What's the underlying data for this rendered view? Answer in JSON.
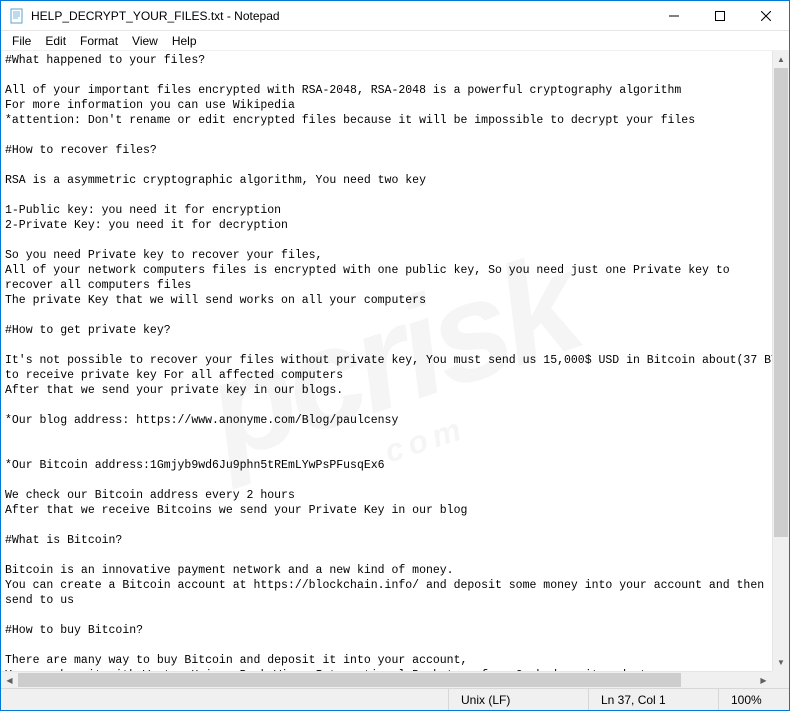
{
  "window": {
    "title": "HELP_DECRYPT_YOUR_FILES.txt - Notepad"
  },
  "menu": {
    "file": "File",
    "edit": "Edit",
    "format": "Format",
    "view": "View",
    "help": "Help"
  },
  "document": {
    "text": "#What happened to your files?\n\nAll of your important files encrypted with RSA-2048, RSA-2048 is a powerful cryptography algorithm\nFor more information you can use Wikipedia\n*attention: Don't rename or edit encrypted files because it will be impossible to decrypt your files\n\n#How to recover files?\n\nRSA is a asymmetric cryptographic algorithm, You need two key\n\n1-Public key: you need it for encryption\n2-Private Key: you need it for decryption\n\nSo you need Private key to recover your files,\nAll of your network computers files is encrypted with one public key, So you need just one Private key to\nrecover all computers files\nThe private Key that we will send works on all your computers\n\n#How to get private key?\n\nIt's not possible to recover your files without private key, You must send us 15,000$ USD in Bitcoin about(37 BTC)\nto receive private key For all affected computers\nAfter that we send your private key in our blogs.\n\n*Our blog address: https://www.anonyme.com/Blog/paulcensy\n\n\n*Our Bitcoin address:1Gmjyb9wd6Ju9phn5tREmLYwPsPFusqEx6\n\nWe check our Bitcoin address every 2 hours\nAfter that we receive Bitcoins we send your Private Key in our blog\n\n#What is Bitcoin?\n\nBitcoin is an innovative payment network and a new kind of money.\nYou can create a Bitcoin account at https://blockchain.info/ and deposit some money into your account and then\nsend to us\n\n#How to buy Bitcoin?\n\nThere are many way to buy Bitcoin and deposit it into your account,\nYou can buy it with WesternUnion, Bank Wire, International Bank transfer, Cash deposit and etc\n\nhttps://localbitcoins.com ---> Buy Bitcoin with WesternUnion or MoneyGram\n\nhttps://coincafe.com ---> Buy Bitcoin fast and Secure with WesternUnion and Cash deposit\n\nhttps://www.bitstamp.net ---> Buy Bitcoin with bank wire, International bank transfer, SEPA payment"
  },
  "status": {
    "line_ending": "Unix (LF)",
    "cursor": "Ln 37, Col 1",
    "zoom": "100%"
  }
}
